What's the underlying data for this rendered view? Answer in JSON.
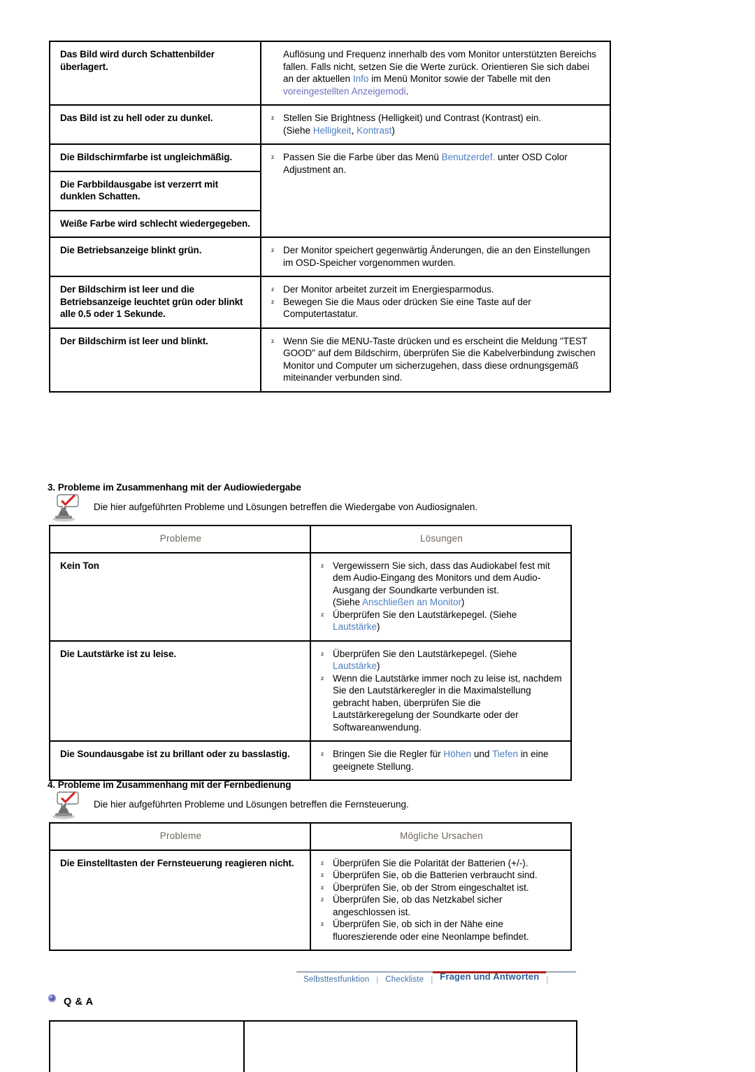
{
  "table1": {
    "rows": [
      {
        "problem": "Das Bild wird durch Schattenbilder überlagert.",
        "solution_lines": [
          {
            "bullet": false,
            "parts": [
              {
                "t": "Auflösung und Frequenz innerhalb des vom Monitor unterstützten Bereichs fallen. Falls nicht, setzen Sie die Werte zurück. Orientieren Sie sich dabei an der aktuellen ",
                "style": "plain"
              },
              {
                "t": "Info",
                "style": "link"
              },
              {
                "t": " im Menü Monitor sowie der Tabelle mit den ",
                "style": "plain"
              },
              {
                "t": "voreingestellten Anzeigemodi",
                "style": "link-visited"
              },
              {
                "t": ".",
                "style": "plain"
              }
            ]
          }
        ]
      },
      {
        "problem": "Das Bild ist zu hell oder zu dunkel.",
        "solution_lines": [
          {
            "bullet": true,
            "parts": [
              {
                "t": "Stellen Sie Brightness (Helligkeit) und Contrast (Kontrast) ein.",
                "style": "plain"
              }
            ]
          },
          {
            "bullet": false,
            "parts": [
              {
                "t": "(Siehe ",
                "style": "plain"
              },
              {
                "t": "Helligkeit",
                "style": "link"
              },
              {
                "t": ", ",
                "style": "plain"
              },
              {
                "t": "Kontrast",
                "style": "link"
              },
              {
                "t": ")",
                "style": "plain"
              }
            ]
          }
        ]
      },
      {
        "problem": "Die Bildschirmfarbe ist ungleichmäßig.",
        "solution_lines": [
          {
            "bullet": true,
            "parts": [
              {
                "t": "Passen Sie die Farbe über das Menü ",
                "style": "plain"
              },
              {
                "t": "Benutzerdef.",
                "style": "link"
              },
              {
                "t": " unter OSD Color Adjustment an.",
                "style": "plain"
              }
            ]
          }
        ],
        "rowspan_solution": 3
      },
      {
        "problem": "Die Farbbildausgabe ist verzerrt mit dunklen Schatten.",
        "solution_lines": []
      },
      {
        "problem": "Weiße Farbe wird schlecht wiedergegeben.",
        "solution_lines": []
      },
      {
        "problem": "Die Betriebsanzeige blinkt grün.",
        "solution_lines": [
          {
            "bullet": true,
            "parts": [
              {
                "t": "Der Monitor speichert gegenwärtig Änderungen, die an den Einstellungen im OSD-Speicher vorgenommen wurden.",
                "style": "plain"
              }
            ]
          }
        ]
      },
      {
        "problem": "Der Bildschirm ist leer und die Betriebsanzeige leuchtet grün oder blinkt alle 0.5 oder 1 Sekunde.",
        "solution_lines": [
          {
            "bullet": true,
            "parts": [
              {
                "t": "Der Monitor arbeitet zurzeit im Energiesparmodus.",
                "style": "plain"
              }
            ]
          },
          {
            "bullet": true,
            "parts": [
              {
                "t": "Bewegen Sie die Maus oder drücken Sie eine Taste auf der Computertastatur.",
                "style": "plain"
              }
            ]
          }
        ]
      },
      {
        "problem": "Der Bildschirm ist leer und blinkt.",
        "solution_lines": [
          {
            "bullet": true,
            "parts": [
              {
                "t": "Wenn Sie die MENU-Taste drücken und es erscheint die Meldung \"TEST GOOD\" auf dem Bildschirm, überprüfen Sie die Kabelverbindung zwischen Monitor und Computer um sicherzugehen, dass diese ordnungsgemäß miteinander verbunden sind.",
                "style": "plain"
              }
            ]
          }
        ]
      }
    ]
  },
  "section3": {
    "heading": "3. Probleme im Zusammenhang mit der Audiowiedergabe",
    "note": "Die hier aufgeführten Probleme und Lösungen betreffen die Wiedergabe von Audiosignalen.",
    "icon": "notice-check-icon",
    "headers": {
      "col1": "Probleme",
      "col2": "Lösungen"
    },
    "rows": [
      {
        "problem": "Kein Ton",
        "solution_lines": [
          {
            "bullet": true,
            "parts": [
              {
                "t": "Vergewissern Sie sich, dass das Audiokabel fest mit dem Audio-Eingang des Monitors und dem Audio-Ausgang der Soundkarte verbunden ist.",
                "style": "plain"
              }
            ]
          },
          {
            "bullet": false,
            "parts": [
              {
                "t": "(Siehe ",
                "style": "plain"
              },
              {
                "t": "Anschließen an Monitor",
                "style": "link"
              },
              {
                "t": ")",
                "style": "plain"
              }
            ]
          },
          {
            "bullet": true,
            "parts": [
              {
                "t": "Überprüfen Sie den Lautstärkepegel. (Siehe ",
                "style": "plain"
              },
              {
                "t": "Lautstärke",
                "style": "link"
              },
              {
                "t": ")",
                "style": "plain"
              }
            ]
          }
        ]
      },
      {
        "problem": "Die Lautstärke ist zu leise.",
        "solution_lines": [
          {
            "bullet": true,
            "parts": [
              {
                "t": "Überprüfen Sie den Lautstärkepegel. (Siehe ",
                "style": "plain"
              },
              {
                "t": "Lautstärke",
                "style": "link"
              },
              {
                "t": ")",
                "style": "plain"
              }
            ]
          },
          {
            "bullet": true,
            "parts": [
              {
                "t": "Wenn die Lautstärke immer noch zu leise ist, nachdem Sie den Lautstärkeregler in die Maximalstellung gebracht haben, überprüfen Sie die Lautstärkeregelung der Soundkarte oder der Softwareanwendung.",
                "style": "plain"
              }
            ]
          }
        ]
      },
      {
        "problem": "Die Soundausgabe ist zu brillant oder zu basslastig.",
        "solution_lines": [
          {
            "bullet": true,
            "parts": [
              {
                "t": "Bringen Sie die Regler für ",
                "style": "plain"
              },
              {
                "t": "Höhen",
                "style": "link"
              },
              {
                "t": " und ",
                "style": "plain"
              },
              {
                "t": "Tiefen",
                "style": "link"
              },
              {
                "t": " in eine geeignete Stellung.",
                "style": "plain"
              }
            ]
          }
        ]
      }
    ]
  },
  "section4": {
    "heading": "4. Probleme im Zusammenhang mit der Fernbedienung",
    "note": "Die hier aufgeführten Probleme und Lösungen betreffen die Fernsteuerung.",
    "icon": "notice-check-icon",
    "headers": {
      "col1": "Probleme",
      "col2": "Mögliche Ursachen"
    },
    "rows": [
      {
        "problem": "Die Einstelltasten der Fernsteuerung reagieren nicht.",
        "solution_lines": [
          {
            "bullet": true,
            "parts": [
              {
                "t": "Überprüfen Sie die Polarität der Batterien (+/-).",
                "style": "plain"
              }
            ]
          },
          {
            "bullet": true,
            "parts": [
              {
                "t": "Überprüfen Sie, ob die Batterien verbraucht sind.",
                "style": "plain"
              }
            ]
          },
          {
            "bullet": true,
            "parts": [
              {
                "t": "Überprüfen Sie, ob der Strom eingeschaltet ist.",
                "style": "plain"
              }
            ]
          },
          {
            "bullet": true,
            "parts": [
              {
                "t": "Überprüfen Sie, ob das Netzkabel sicher angeschlossen ist.",
                "style": "plain"
              }
            ]
          },
          {
            "bullet": true,
            "parts": [
              {
                "t": "Überprüfen Sie, ob sich in der Nähe eine fluoreszierende oder eine Neonlampe befindet.",
                "style": "plain"
              }
            ]
          }
        ]
      }
    ]
  },
  "nav": {
    "items": [
      {
        "label": "Selbsttestfunktion",
        "active": false
      },
      {
        "label": "Checkliste",
        "active": false
      },
      {
        "label": "Fragen und Antworten",
        "active": true
      }
    ],
    "separator": "|",
    "active_color": "#b01c1c",
    "link_color": "#3f6ea8"
  },
  "qa": {
    "label": "Q & A",
    "bullet_icon": "bullet-orb-icon",
    "bullet_color": "#6a6ac0"
  },
  "colors": {
    "link": "#4b7fc0",
    "link_visited": "#6f6fc0",
    "header_text": "#6d665c",
    "border": "#000000",
    "accent_red": "#b01c1c"
  }
}
